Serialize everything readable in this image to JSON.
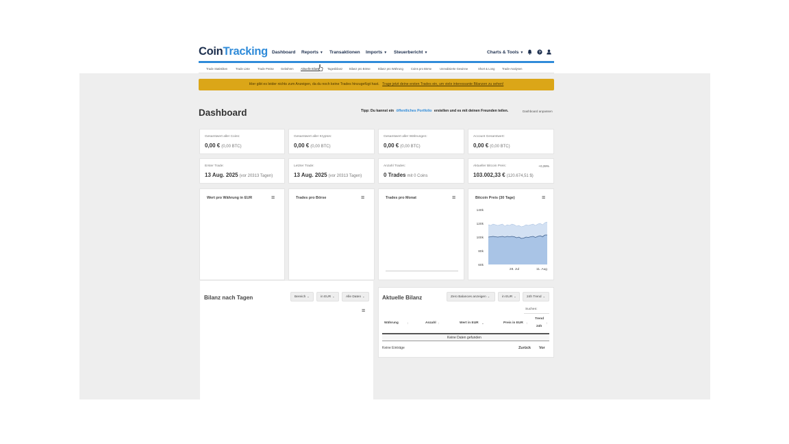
{
  "header": {
    "logo_main": "Coin",
    "logo_accent": "Tracking",
    "nav": [
      {
        "label": "Dashboard",
        "caret": ""
      },
      {
        "label": "Reports",
        "caret": "▼"
      },
      {
        "label": "Transaktionen",
        "caret": ""
      },
      {
        "label": "Imports",
        "caret": "▼"
      },
      {
        "label": "Steuerbericht",
        "caret": "▼"
      }
    ],
    "charts_tools": {
      "label": "Charts & Tools",
      "caret": "▼"
    },
    "icons": [
      "bell-icon",
      "help-icon",
      "user-icon"
    ]
  },
  "subnav": [
    "Trade Statistiken",
    "Trade Liste",
    "Trade Preise",
    "Gebühren",
    "Aktuelle Bilanz",
    "Tagesbilanz",
    "Bilanz pro Börse",
    "Bilanz pro Währung",
    "Coins pro Börse",
    "Unrealisierte Gewinne",
    "Short & Long",
    "Trade-Analysen"
  ],
  "subnav_active_index": 4,
  "banner": {
    "text": "Hier gibt es leider nichts zum Anzeigen, da du noch keine Trades hinzugefügt hast.",
    "link": "Trage jetzt deine ersten Trades ein, um viele interessante Bilanzen zu sehen!"
  },
  "dashboard": {
    "title": "Dashboard",
    "tip_prefix": "Tipp:",
    "tip_text1": "Du kannst ein",
    "tip_link": "öffentliches Portfolio",
    "tip_text2": "erstellen und es mit deinen Freunden teilen.",
    "customize": "Dashboard anpassen"
  },
  "stats": [
    {
      "label": "Gesamtwert aller Coins:",
      "value": "0,00 €",
      "sub": "(0,00 BTC)",
      "change": ""
    },
    {
      "label": "Gesamtwert aller Kryptos:",
      "value": "0,00 €",
      "sub": "(0,00 BTC)",
      "change": ""
    },
    {
      "label": "Gesamtwert aller Währungen:",
      "value": "0,00 €",
      "sub": "(0,00 BTC)",
      "change": ""
    },
    {
      "label": "Account Gesamtwert:",
      "value": "0,00 €",
      "sub": "(0,00 BTC)",
      "change": ""
    },
    {
      "label": "Erster Trade:",
      "value": "13 Aug. 2025",
      "sub": "(vor 20313 Tagen)",
      "change": ""
    },
    {
      "label": "Letzter Trade:",
      "value": "13 Aug. 2025",
      "sub": "(vor 20313 Tagen)",
      "change": ""
    },
    {
      "label": "Anzahl Trades:",
      "value": "0 Trades",
      "sub": "mit 0 Coins",
      "change": ""
    },
    {
      "label": "Aktueller Bitcoin Preis:",
      "value": "103.002,33 €",
      "sub": "(120.674,51 $)",
      "change": "+0,39%"
    }
  ],
  "panels": [
    {
      "title": "Wert pro Währung in EUR"
    },
    {
      "title": "Trades pro Börse"
    },
    {
      "title": "Trades pro Monat"
    },
    {
      "title": "Bitcoin Preis (30 Tage)"
    }
  ],
  "chart_data": {
    "type": "area",
    "title": "Bitcoin Preis (30 Tage)",
    "xlabel": "",
    "ylabel": "",
    "ylim": [
      60,
      140
    ],
    "yticks": [
      "140k",
      "120k",
      "100k",
      "80k",
      "60k"
    ],
    "xticks": [
      "28. Jul",
      "11. Aug"
    ],
    "grid": false,
    "series": [
      {
        "values": [
          118,
          117,
          119,
          118,
          117,
          118,
          119,
          116,
          118,
          117,
          119,
          118,
          116,
          117,
          115,
          116,
          118,
          117,
          118,
          119,
          117,
          119,
          120,
          118,
          121,
          122
        ]
      },
      {
        "values": [
          100,
          100.5,
          101,
          100.5,
          100,
          100.5,
          101,
          100,
          101,
          100.5,
          101,
          100.5,
          99,
          100,
          98,
          98.5,
          100,
          99.5,
          100.5,
          101,
          99.5,
          101,
          102,
          100.5,
          103,
          103
        ]
      }
    ]
  },
  "bilanz_tage": {
    "title": "Bilanz nach Tagen",
    "dropdowns": [
      {
        "label": "Bereich",
        "caret": "⌄"
      },
      {
        "label": "in EUR",
        "caret": "⌄"
      },
      {
        "label": "Alle Daten",
        "caret": "⌄"
      }
    ]
  },
  "aktuelle_bilanz": {
    "title": "Aktuelle Bilanz",
    "dropdowns": [
      {
        "label": "Zero Balances anzeigen",
        "caret": "⌄"
      },
      {
        "label": "in EUR",
        "caret": "⌄"
      },
      {
        "label": "24h Trend",
        "caret": "⌄"
      }
    ],
    "search_label": "Suchen:",
    "columns": [
      "Währung",
      "Anzahl",
      "Wert in EUR",
      "Preis in EUR",
      "Trend",
      "24h"
    ],
    "empty": "Keine Daten gefunden",
    "info": "Keine Einträge",
    "prev": "Zurück",
    "next": "Vor"
  }
}
